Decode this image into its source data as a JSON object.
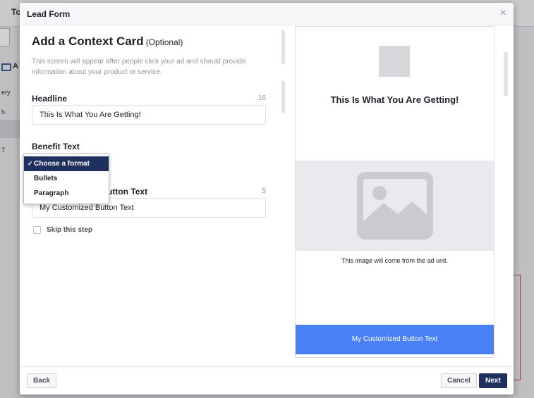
{
  "background": {
    "topbar_text": "To",
    "tab_text": "A",
    "cells": [
      "ery",
      "h",
      "7"
    ]
  },
  "modal": {
    "title": "Lead Form",
    "close_glyph": "×"
  },
  "form": {
    "section_title": "Add a Context Card",
    "section_optional": "(Optional)",
    "description": "This screen will appear after people click your ad and should provide information about your product or service.",
    "headline_label": "Headline",
    "headline_count": "16",
    "headline_value": "This Is What You Are Getting!",
    "benefit_label": "Benefit Text",
    "button_label_partial": "utton Text",
    "button_count": "5",
    "button_value": "My Customized Button Text",
    "skip_label": "Skip this step",
    "skip_checked": false
  },
  "format_dropdown": {
    "check_glyph": "✓",
    "selected": "Choose a format",
    "options": [
      "Bullets",
      "Paragraph"
    ]
  },
  "preview": {
    "headline": "This Is What You Are Getting!",
    "caption": "This image will come from the ad unit.",
    "button_text": "My Customized Button Text",
    "image_icon": "image-placeholder-icon"
  },
  "footer": {
    "back_label": "Back",
    "cancel_label": "Cancel",
    "next_label": "Next"
  },
  "colors": {
    "accent": "#20305e",
    "preview_button": "#4a80f5",
    "placeholder": "#d7d8dc"
  }
}
